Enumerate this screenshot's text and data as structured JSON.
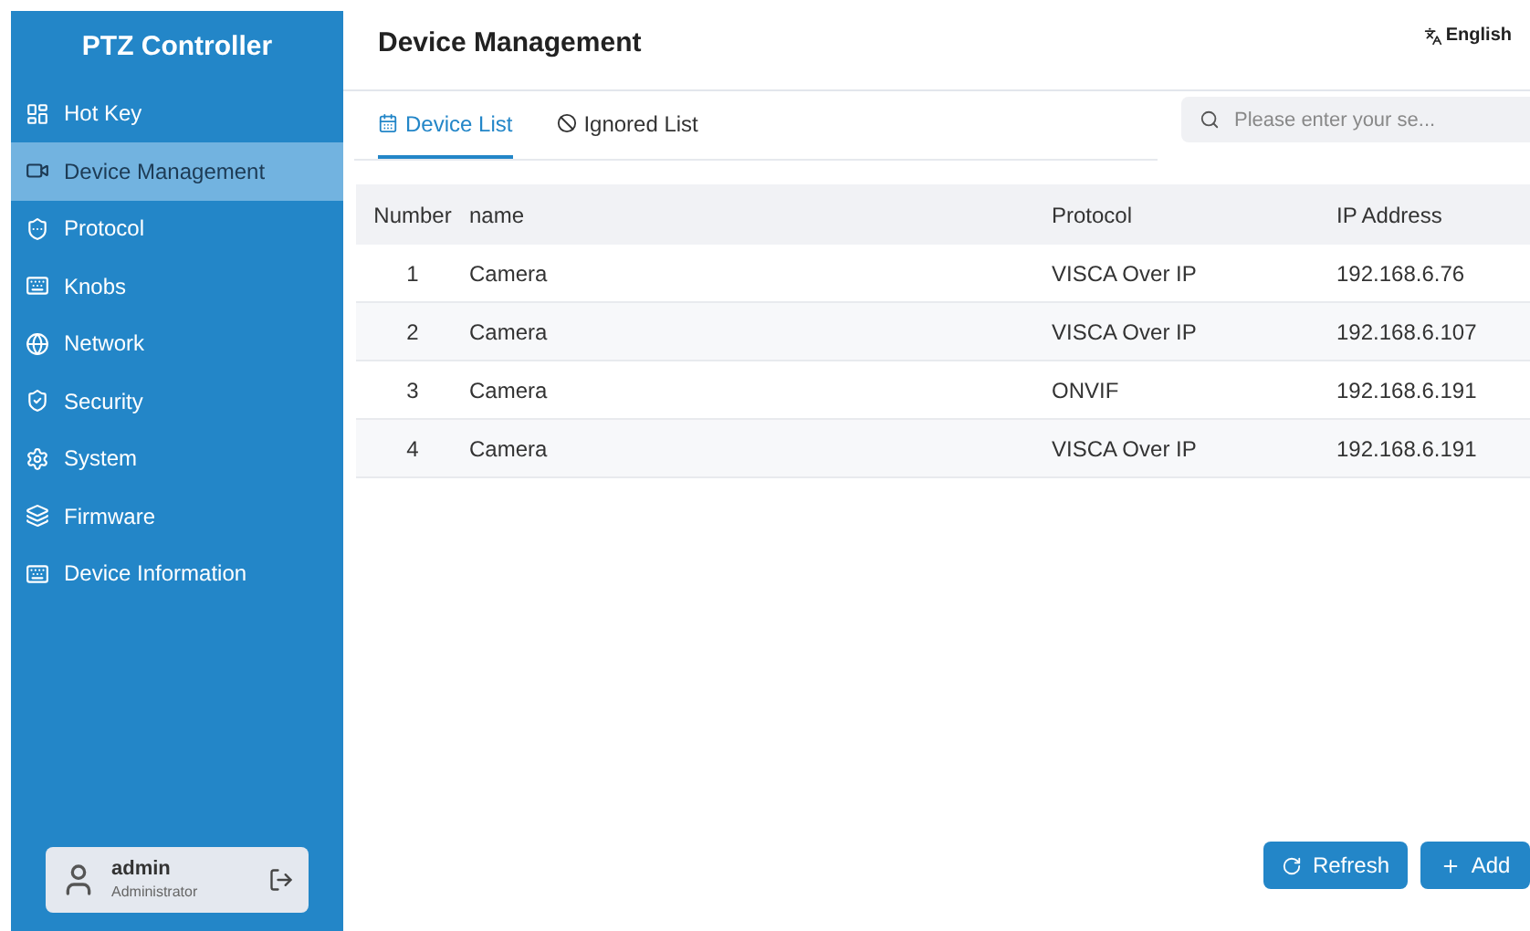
{
  "sidebar": {
    "title": "PTZ Controller",
    "items": [
      {
        "label": "Hot Key",
        "selected": false
      },
      {
        "label": "Device Management",
        "selected": true
      },
      {
        "label": "Protocol",
        "selected": false
      },
      {
        "label": "Knobs",
        "selected": false
      },
      {
        "label": "Network",
        "selected": false
      },
      {
        "label": "Security",
        "selected": false
      },
      {
        "label": "System",
        "selected": false
      },
      {
        "label": "Firmware",
        "selected": false
      },
      {
        "label": "Device Information",
        "selected": false
      }
    ],
    "user": {
      "name": "admin",
      "role": "Administrator"
    }
  },
  "header": {
    "title": "Device Management",
    "language": "English"
  },
  "tabs": [
    {
      "label": "Device List",
      "selected": true
    },
    {
      "label": "Ignored List",
      "selected": false
    }
  ],
  "search": {
    "placeholder": "Please enter your se..."
  },
  "table": {
    "columns": [
      "Number",
      "name",
      "Protocol",
      "IP Address"
    ],
    "rows": [
      [
        "1",
        "Camera",
        "VISCA Over IP",
        "192.168.6.76"
      ],
      [
        "2",
        "Camera",
        "VISCA Over IP",
        "192.168.6.107"
      ],
      [
        "3",
        "Camera",
        "ONVIF",
        "192.168.6.191"
      ],
      [
        "4",
        "Camera",
        "VISCA Over IP",
        "192.168.6.191"
      ]
    ]
  },
  "buttons": [
    {
      "label": "Refresh",
      "kind": "refresh"
    },
    {
      "label": "Add",
      "kind": "add"
    }
  ]
}
